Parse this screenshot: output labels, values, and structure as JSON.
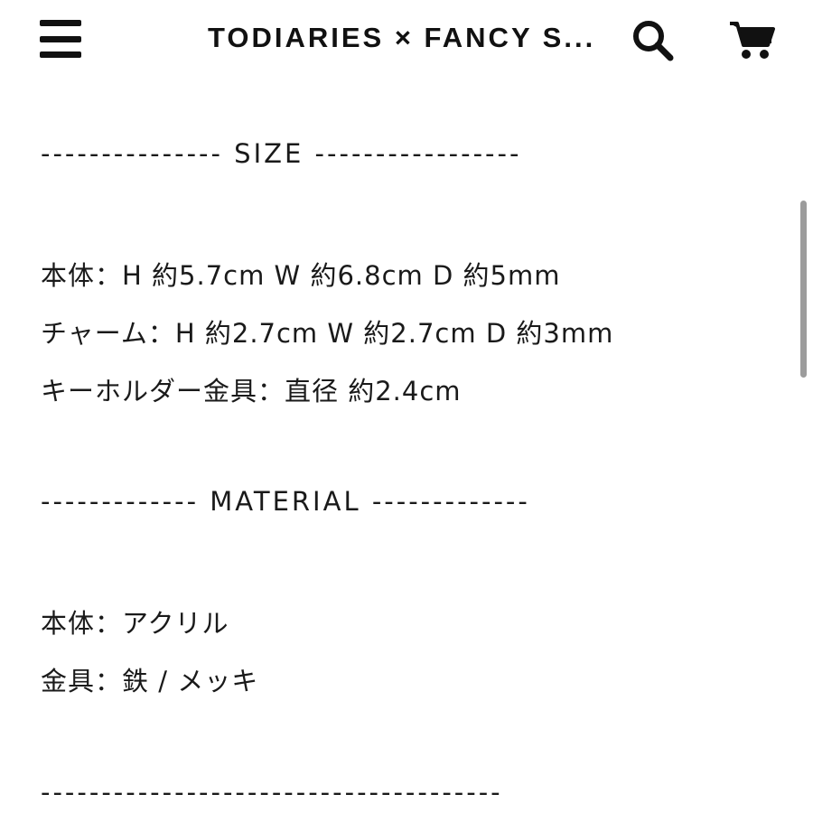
{
  "header": {
    "title": "TODIARIES × FANCY S...",
    "menu_icon": "hamburger-menu-icon",
    "search_icon": "search-icon",
    "cart_icon": "cart-icon"
  },
  "content": {
    "size_divider": "--------------- SIZE -----------------",
    "size_lines": [
      "本体：H 約5.7cm W 約6.8cm D 約5mm",
      "チャーム：H 約2.7cm W 約2.7cm D 約3mm",
      "キーホルダー金具：直径 約2.4cm"
    ],
    "material_divider": "------------- MATERIAL -------------",
    "material_lines": [
      "本体：アクリル",
      "金具：鉄 / メッキ"
    ],
    "bottom_divider": "--------------------------------------"
  }
}
